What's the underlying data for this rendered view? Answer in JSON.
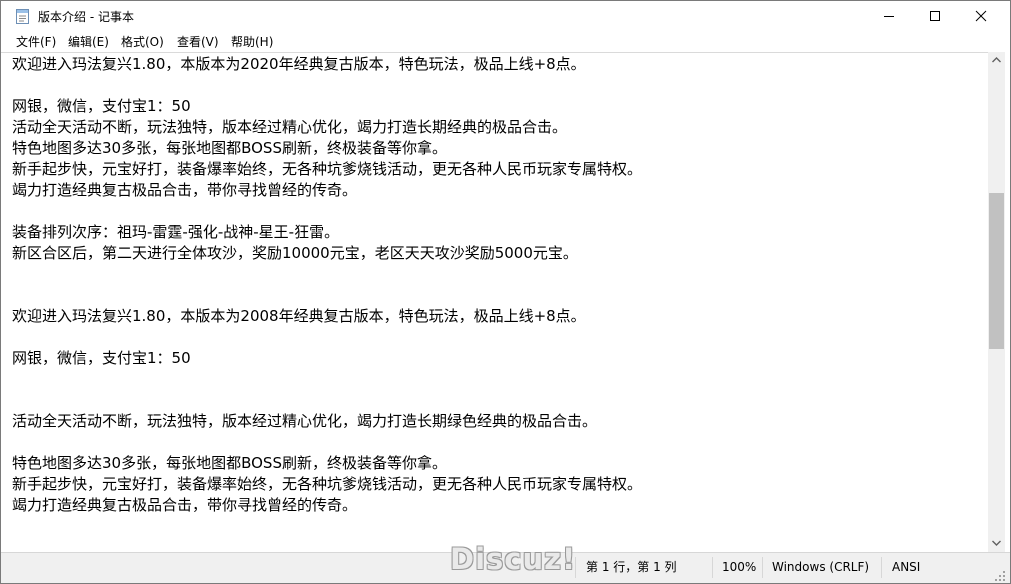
{
  "window": {
    "title": "版本介绍 - 记事本"
  },
  "menu": {
    "file": "文件(F)",
    "edit": "编辑(E)",
    "format": "格式(O)",
    "view": "查看(V)",
    "help": "帮助(H)"
  },
  "document": {
    "lines": [
      "欢迎进入玛法复兴1.80，本版本为2020年经典复古版本，特色玩法，极品上线+8点。",
      "",
      "网银，微信，支付宝1：50",
      "活动全天活动不断，玩法独特，版本经过精心优化，竭力打造长期经典的极品合击。",
      "特色地图多达30多张，每张地图都BOSS刷新，终极装备等你拿。",
      "新手起步快，元宝好打，装备爆率始终，无各种坑爹烧钱活动，更无各种人民币玩家专属特权。",
      "竭力打造经典复古极品合击，带你寻找曾经的传奇。",
      "",
      "装备排列次序：祖玛-雷霆-强化-战神-星王-狂雷。",
      "新区合区后，第二天进行全体攻沙，奖励10000元宝，老区天天攻沙奖励5000元宝。",
      "",
      "",
      "欢迎进入玛法复兴1.80，本版本为2008年经典复古版本，特色玩法，极品上线+8点。",
      "",
      "网银，微信，支付宝1：50",
      "",
      "",
      "活动全天活动不断，玩法独特，版本经过精心优化，竭力打造长期绿色经典的极品合击。",
      "",
      "特色地图多达30多张，每张地图都BOSS刷新，终极装备等你拿。",
      "新手起步快，元宝好打，装备爆率始终，无各种坑爹烧钱活动，更无各种人民币玩家专属特权。",
      "竭力打造经典复古极品合击，带你寻找曾经的传奇。"
    ]
  },
  "status": {
    "position": "第 1 行，第 1 列",
    "zoom": "100%",
    "line_ending": "Windows (CRLF)",
    "encoding": "ANSI"
  },
  "watermark": "Discuz!",
  "colors": {
    "window_border": "#7a7a7a",
    "statusbar_bg": "#f0f0f0",
    "scroll_thumb": "#c1c1c1"
  },
  "icons": {
    "app": "notepad-icon",
    "minimize": "minimize-icon",
    "maximize": "maximize-icon",
    "close": "close-icon",
    "scroll_up": "chevron-up-icon",
    "scroll_down": "chevron-down-icon",
    "grip": "resize-grip-icon"
  }
}
